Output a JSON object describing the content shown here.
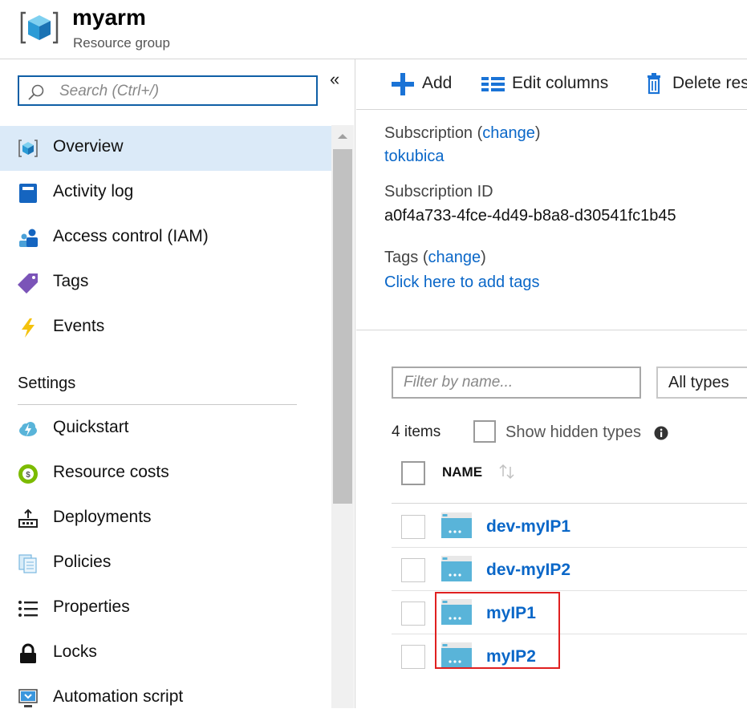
{
  "header": {
    "title": "myarm",
    "subtitle": "Resource group"
  },
  "sidebar": {
    "search_placeholder": "Search (Ctrl+/)",
    "collapse_glyph": "«",
    "items": [
      {
        "label": "Overview",
        "icon": "resource-group-cube-icon",
        "active": true
      },
      {
        "label": "Activity log",
        "icon": "activity-log-icon"
      },
      {
        "label": "Access control (IAM)",
        "icon": "iam-users-icon"
      },
      {
        "label": "Tags",
        "icon": "tag-icon"
      },
      {
        "label": "Events",
        "icon": "lightning-icon"
      }
    ],
    "settings_heading": "Settings",
    "settings_items": [
      {
        "label": "Quickstart",
        "icon": "cloud-lightning-icon"
      },
      {
        "label": "Resource costs",
        "icon": "cost-coin-icon"
      },
      {
        "label": "Deployments",
        "icon": "deployments-icon"
      },
      {
        "label": "Policies",
        "icon": "policies-icon"
      },
      {
        "label": "Properties",
        "icon": "list-icon"
      },
      {
        "label": "Locks",
        "icon": "lock-icon"
      },
      {
        "label": "Automation script",
        "icon": "automation-script-icon"
      }
    ]
  },
  "toolbar": {
    "add_label": "Add",
    "edit_columns_label": "Edit columns",
    "delete_label": "Delete res"
  },
  "essentials": {
    "subscription_label": "Subscription",
    "change_label": "change",
    "subscription_value": "tokubica",
    "subscription_id_label": "Subscription ID",
    "subscription_id_value": "a0f4a733-4fce-4d49-b8a8-d30541fc1b45",
    "tags_label": "Tags",
    "tags_change_label": "change",
    "tags_value": "Click here to add tags"
  },
  "resources": {
    "filter_placeholder": "Filter by name...",
    "types_selected": "All types",
    "items_count": "4 items",
    "show_hidden_label": "Show hidden types",
    "name_column": "NAME",
    "rows": [
      {
        "name": "dev-myIP1",
        "icon": "public-ip-icon"
      },
      {
        "name": "dev-myIP2",
        "icon": "public-ip-icon"
      },
      {
        "name": "myIP1",
        "icon": "public-ip-icon"
      },
      {
        "name": "myIP2",
        "icon": "public-ip-icon"
      }
    ]
  },
  "colors": {
    "accent": "#0a67c8",
    "active_nav_bg": "#dbeaf8",
    "highlight": "#e02020"
  }
}
